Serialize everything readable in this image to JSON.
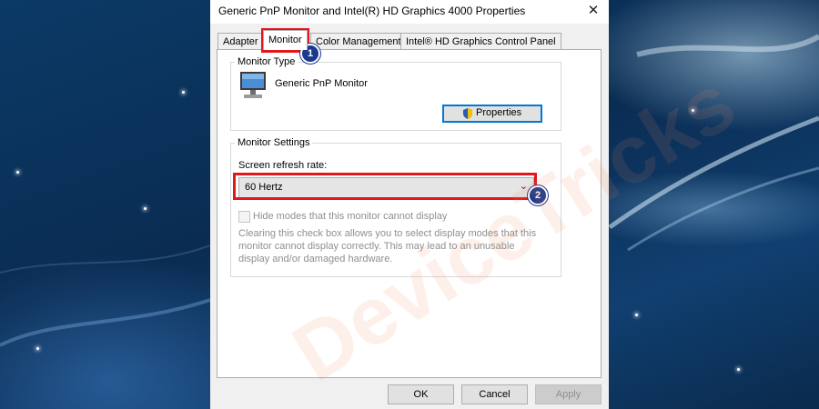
{
  "window": {
    "title": "Generic PnP Monitor and Intel(R) HD Graphics 4000 Properties",
    "close_glyph": "✕"
  },
  "tabs": [
    {
      "label": "Adapter",
      "active": false
    },
    {
      "label": "Monitor",
      "active": true
    },
    {
      "label": "Color Management",
      "active": false
    },
    {
      "label": "Intel® HD Graphics Control Panel",
      "active": false
    }
  ],
  "monitor_type": {
    "legend": "Monitor Type",
    "name": "Generic PnP Monitor",
    "properties_label": "Properties",
    "icon": "monitor-icon",
    "shield_icon": "uac-shield-icon"
  },
  "monitor_settings": {
    "legend": "Monitor Settings",
    "refresh_label": "Screen refresh rate:",
    "refresh_value": "60 Hertz",
    "hide_modes_label": "Hide modes that this monitor cannot display",
    "hide_modes_checked": false,
    "description": "Clearing this check box allows you to select display modes that this monitor cannot display correctly. This may lead to an unusable display and/or damaged hardware."
  },
  "buttons": {
    "ok": "OK",
    "cancel": "Cancel",
    "apply": "Apply"
  },
  "annotations": {
    "badge_1": "1",
    "badge_2": "2",
    "highlight_color": "#e3161c",
    "badge_color": "#1b3a8e"
  },
  "watermark": "DeviceTricks"
}
